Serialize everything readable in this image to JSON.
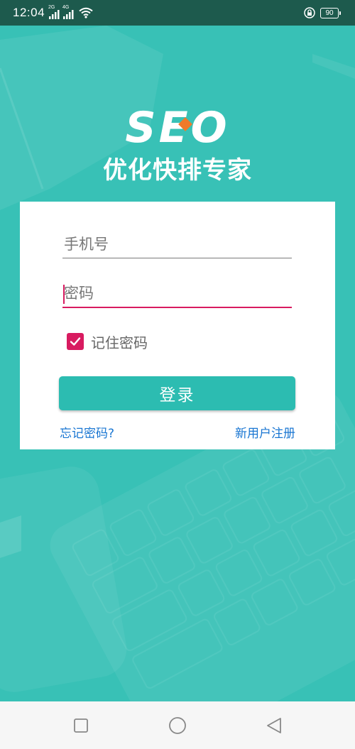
{
  "status_bar": {
    "time": "12:04",
    "signal1_label": "2G",
    "signal2_label": "4G",
    "battery": "90",
    "icons": [
      "signal-icon",
      "signal-icon",
      "wifi-icon",
      "lock-icon",
      "battery-icon"
    ]
  },
  "logo": {
    "mark_text": "SEO",
    "subtitle": "优化快排专家"
  },
  "login_form": {
    "phone_placeholder": "手机号",
    "phone_value": "",
    "password_placeholder": "密码",
    "password_value": "",
    "remember_label": "记住密码",
    "remember_checked": true,
    "login_button": "登录",
    "forgot_link": "忘记密码?",
    "register_link": "新用户注册"
  },
  "nav_bar": {
    "icons": [
      "recent-apps-icon",
      "home-icon",
      "back-icon"
    ]
  },
  "colors": {
    "background": "#38c1b6",
    "status_bar": "#1d5a4d",
    "accent": "#d81b60",
    "button": "#2cbcb1",
    "link": "#1976d2",
    "logo_dot": "#f07a29"
  }
}
